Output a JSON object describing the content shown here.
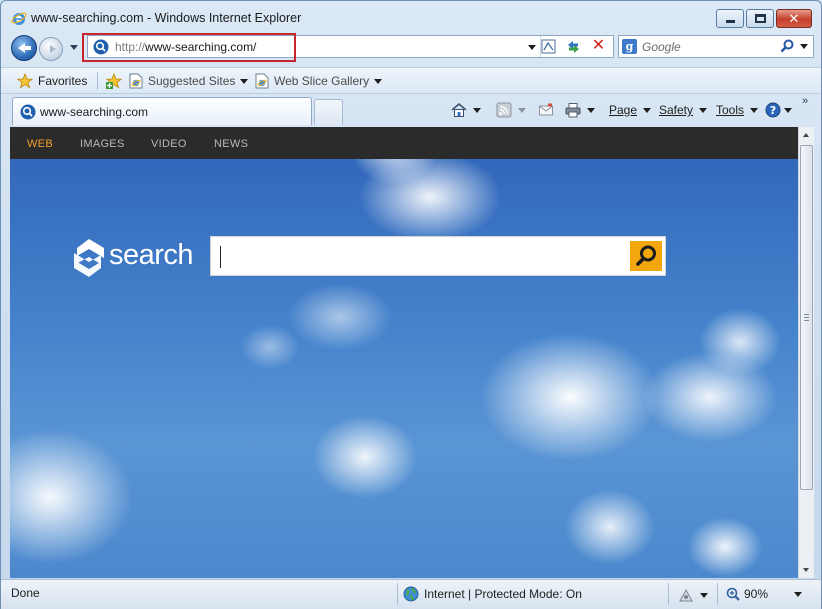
{
  "window": {
    "title": "www-searching.com - Windows Internet Explorer",
    "close_glyph": "✕"
  },
  "navbar": {
    "address_protocol": "http://",
    "address_host": "www-searching.com/",
    "search_placeholder": "Google",
    "search_engine_glyph": "g",
    "stop_glyph": "✕"
  },
  "favorites_bar": {
    "favorites_label": "Favorites",
    "suggested_sites_label": "Suggested Sites",
    "web_slice_gallery_label": "Web Slice Gallery"
  },
  "tab": {
    "label": "www-searching.com"
  },
  "command_bar": {
    "page_label": "Page",
    "safety_label": "Safety",
    "tools_label": "Tools",
    "more_glyph": "»"
  },
  "site": {
    "nav": [
      "WEB",
      "IMAGES",
      "VIDEO",
      "NEWS"
    ],
    "active_nav": "WEB",
    "logo_text": "search",
    "accent": "#f3a70f"
  },
  "status_bar": {
    "status": "Done",
    "zone": "Internet | Protected Mode: On",
    "zoom": "90%"
  }
}
